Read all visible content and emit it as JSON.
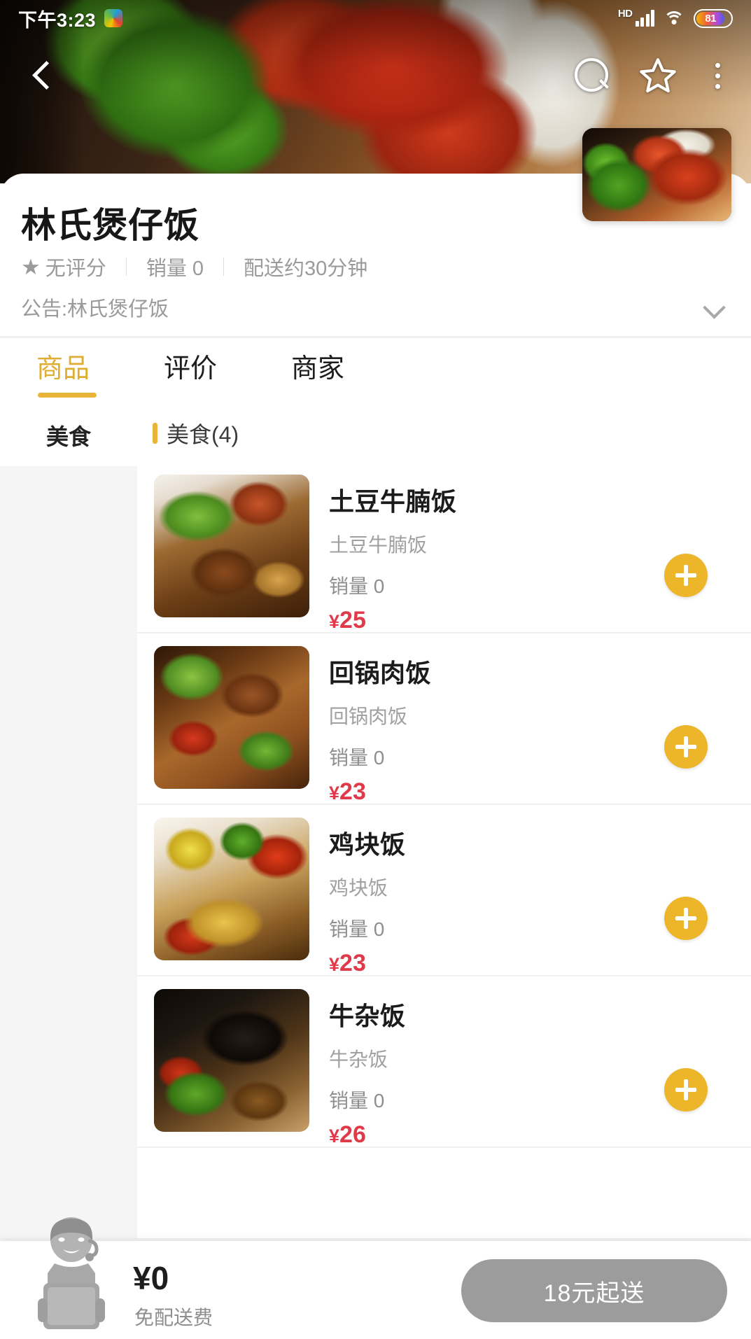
{
  "status_bar": {
    "time": "下午3:23",
    "hd_label": "HD",
    "battery_level": "81",
    "icons": [
      "app-badge-icon",
      "signal-icon",
      "wifi-icon",
      "battery-icon"
    ]
  },
  "nav": {
    "back_icon": "back-chevron-icon",
    "search_icon": "search-icon",
    "favorite_icon": "star-outline-icon",
    "more_icon": "more-vertical-icon"
  },
  "shop": {
    "name": "林氏煲仔饭",
    "rating": "无评分",
    "sales": "销量 0",
    "delivery_time": "配送约30分钟",
    "notice": "公告:林氏煲仔饭",
    "notice_expand_icon": "chevron-down-icon",
    "logo_alt": "restaurant-logo"
  },
  "tabs": [
    {
      "label": "商品",
      "active": true
    },
    {
      "label": "评价",
      "active": false
    },
    {
      "label": "商家",
      "active": false
    }
  ],
  "sidebar": {
    "items": [
      {
        "label": "美食",
        "active": true
      }
    ]
  },
  "menu": {
    "section_title": "美食(4)",
    "items": [
      {
        "name": "土豆牛腩饭",
        "desc": "土豆牛腩饭",
        "sales": "销量 0",
        "currency": "¥",
        "price": "25",
        "add_icon": "plus-icon"
      },
      {
        "name": "回锅肉饭",
        "desc": "回锅肉饭",
        "sales": "销量 0",
        "currency": "¥",
        "price": "23",
        "add_icon": "plus-icon"
      },
      {
        "name": "鸡块饭",
        "desc": "鸡块饭",
        "sales": "销量 0",
        "currency": "¥",
        "price": "23",
        "add_icon": "plus-icon"
      },
      {
        "name": "牛杂饭",
        "desc": "牛杂饭",
        "sales": "销量 0",
        "currency": "¥",
        "price": "26",
        "add_icon": "plus-icon"
      }
    ]
  },
  "cart": {
    "rider_icon": "delivery-rider-icon",
    "amount": "¥0",
    "fee_text": "免配送费",
    "order_button": "18元起送"
  },
  "colors": {
    "accent_gold": "#E8B53A",
    "price_red": "#E03A4A",
    "disabled_gray": "#9C9C9C",
    "sidebar_bg": "#F5F5F5"
  }
}
